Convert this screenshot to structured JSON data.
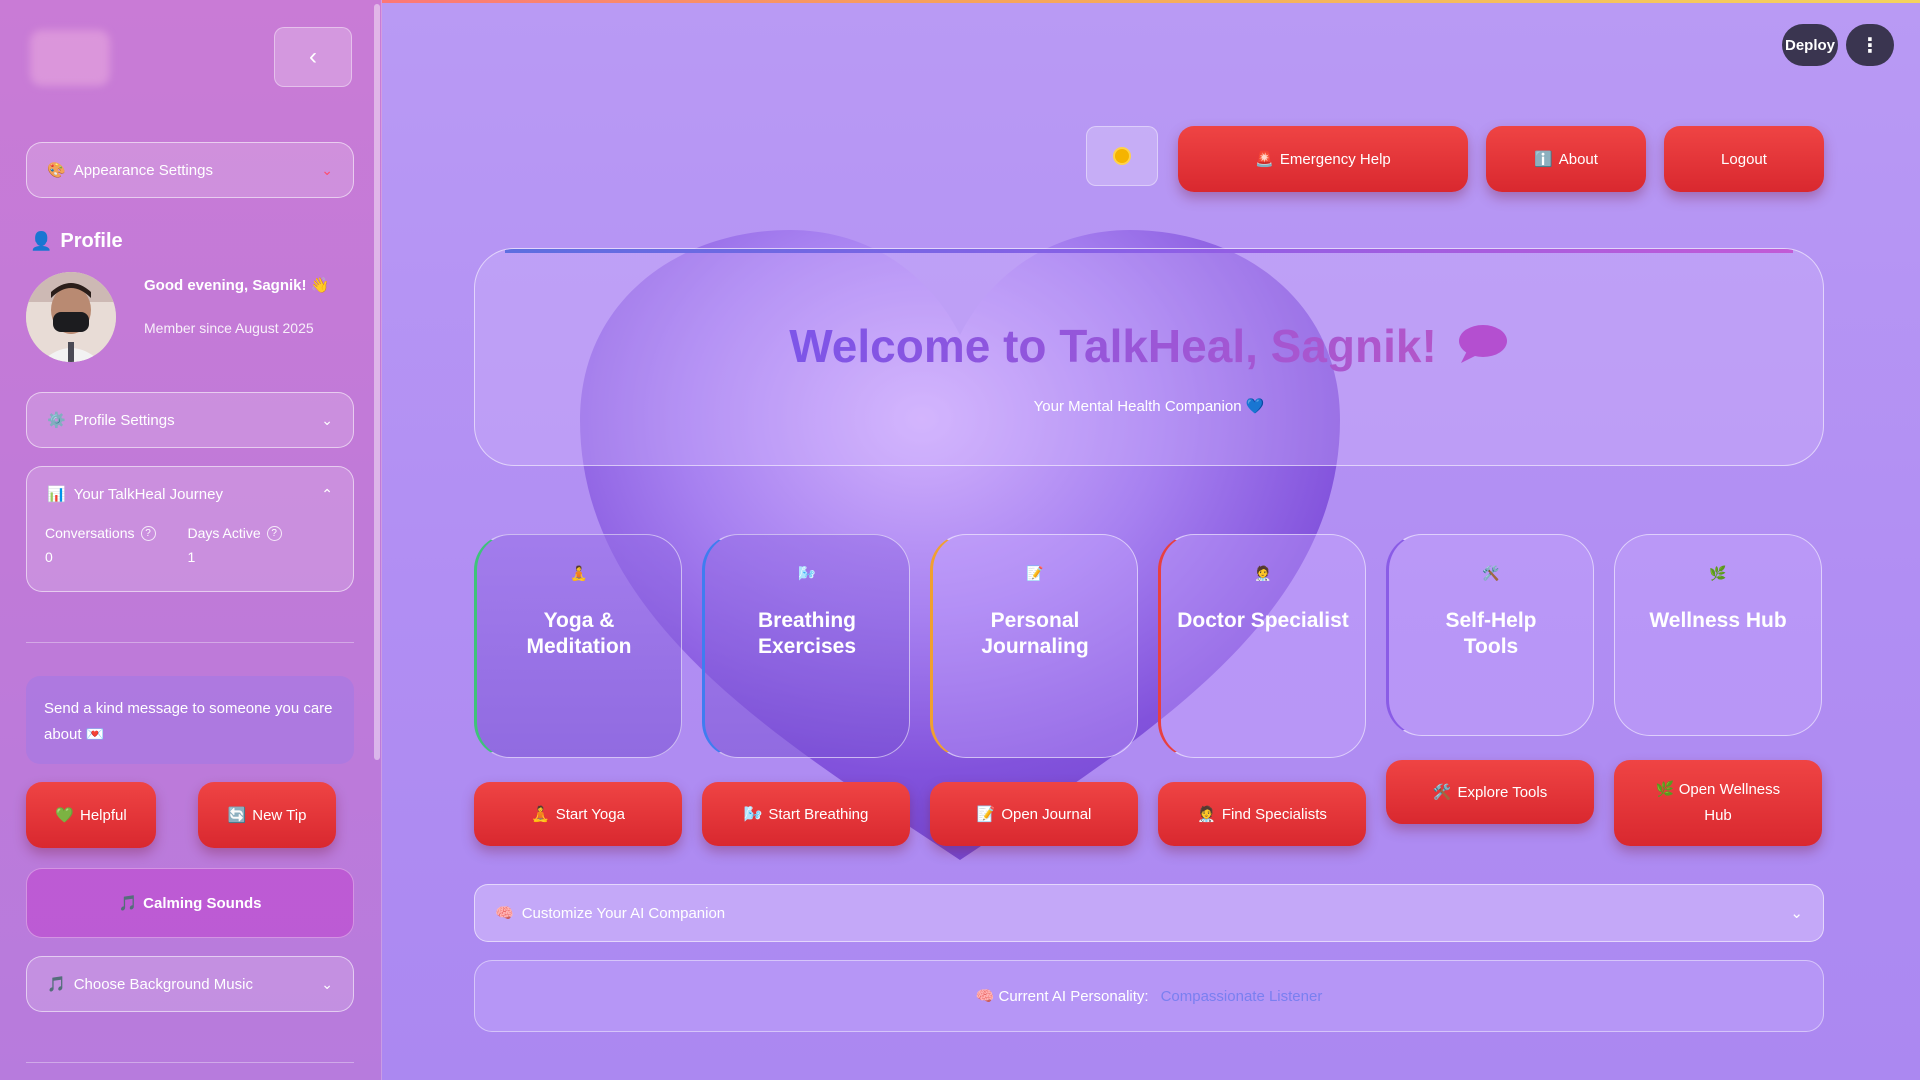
{
  "header": {
    "deploy_label": "Deploy",
    "kebab_label": "⋮",
    "emergency_label": "Emergency Help",
    "about_label": "About",
    "logout_label": "Logout"
  },
  "sidebar": {
    "collapse_icon": "‹",
    "appearance": {
      "label": "Appearance Settings",
      "icon": "🎨",
      "chevron": "⌄"
    },
    "profile_title": "Profile",
    "greeting": "Good evening, Sagnik! 👋",
    "member_since": "Member since August 2025",
    "profile_settings": {
      "label": "Profile Settings",
      "icon": "⚙️",
      "chevron": "⌄"
    },
    "journey": {
      "label": "Your TalkHeal Journey",
      "icon": "📊",
      "chevron": "⌃",
      "stats": [
        {
          "label": "Conversations",
          "value": "0"
        },
        {
          "label": "Days Active",
          "value": "1"
        }
      ]
    },
    "tip_text": "Send a kind message to someone you care about 💌",
    "helpful_label": "Helpful",
    "helpful_icon": "💚",
    "new_tip_label": "New Tip",
    "new_tip_icon": "🔄",
    "calming_label": "Calming Sounds",
    "calming_icon": "🎵",
    "music": {
      "label": "Choose Background Music",
      "icon": "🎵",
      "chevron": "⌄"
    }
  },
  "welcome": {
    "title": "Welcome to TalkHeal, Sagnik!",
    "title_icon": "💬",
    "subtitle": "Your Mental Health Companion 💙"
  },
  "features": [
    {
      "icon": "🧘",
      "title_line1": "Yoga &",
      "title_line2": "Meditation",
      "button": "Start Yoga",
      "button_icon": "🧘"
    },
    {
      "icon": "🌬️",
      "title_line1": "Breathing",
      "title_line2": "Exercises",
      "button": "Start Breathing",
      "button_icon": "🌬️"
    },
    {
      "icon": "📝",
      "title_line1": "Personal",
      "title_line2": "Journaling",
      "button": "Open Journal",
      "button_icon": "📝"
    },
    {
      "icon": "🧑‍⚕️",
      "title_line1": "Doctor Specialist",
      "title_line2": "",
      "button": "Find Specialists",
      "button_icon": "🧑‍⚕️"
    },
    {
      "icon": "🛠️",
      "title_line1": "Self-Help",
      "title_line2": "Tools",
      "button": "Explore Tools",
      "button_icon": "🛠️"
    },
    {
      "icon": "🌿",
      "title_line1": "Wellness Hub",
      "title_line2": "",
      "button_line1": "Open Wellness",
      "button_line2": "Hub",
      "button_icon": "🌿"
    }
  ],
  "customize": {
    "label": "Customize Your AI Companion",
    "icon": "🧠",
    "chevron": "⌄"
  },
  "persona": {
    "label": "Current AI Personality:",
    "value": "Compassionate Listener",
    "icon": "🧠"
  },
  "colors": {
    "accent_red": "#e5393f",
    "sidebar": "#c47ad7",
    "background": "#b596f3",
    "persona_value": "#7a7ff0"
  }
}
